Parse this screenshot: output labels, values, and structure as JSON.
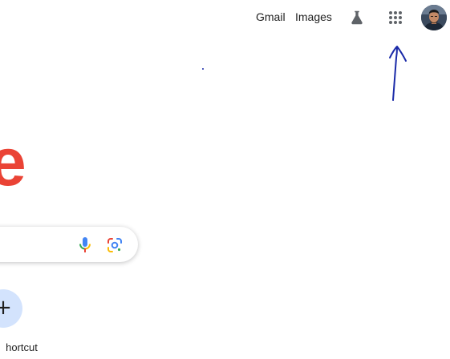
{
  "topbar": {
    "gmail_label": "Gmail",
    "images_label": "Images",
    "labs_icon": "labs-flask-icon",
    "apps_icon": "google-apps-grid-icon",
    "avatar_icon": "account-avatar"
  },
  "logo": {
    "visible_fragment": "e",
    "color": "#ea4335"
  },
  "search": {
    "mic_icon": "voice-search-mic-icon",
    "lens_icon": "google-lens-camera-icon"
  },
  "shortcuts": {
    "add_icon": "plus-icon",
    "add_glyph": "+",
    "add_label": "Add shortcut",
    "visible_label": "hortcut"
  },
  "colors": {
    "blue": "#4285f4",
    "red": "#ea4335",
    "yellow": "#fbbc04",
    "green": "#34a853",
    "annotation": "#1a2aa8",
    "shortcut_bg": "#d3e3fd"
  }
}
